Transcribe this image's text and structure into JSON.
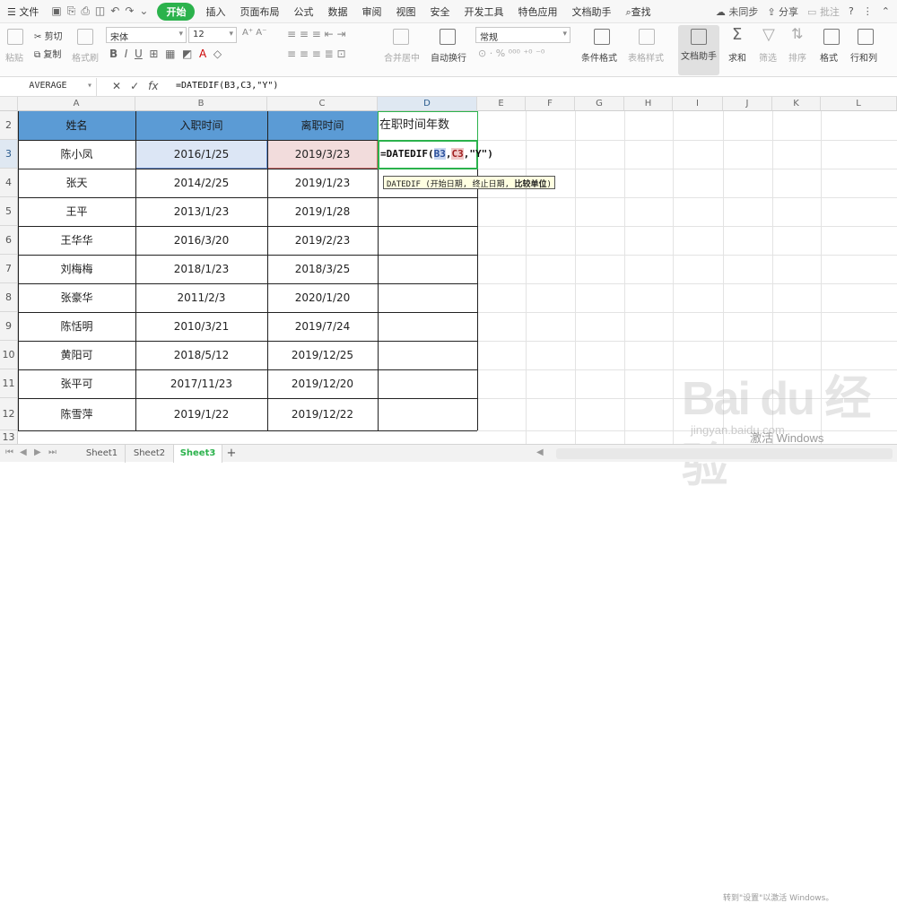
{
  "menubar": {
    "file": "文件",
    "tabs": [
      "开始",
      "插入",
      "页面布局",
      "公式",
      "数据",
      "审阅",
      "视图",
      "安全",
      "开发工具",
      "特色应用",
      "文档助手"
    ],
    "search": "查找",
    "sync": "未同步",
    "share": "分享",
    "comment": "批注",
    "help": "?"
  },
  "ribbon": {
    "paste": "粘贴",
    "cut": "剪切",
    "copy": "复制",
    "format_painter": "格式刷",
    "font_name": "宋体",
    "font_size": "12",
    "merge": "合并居中",
    "wrap": "自动换行",
    "number_format": "常规",
    "cond_format": "条件格式",
    "table_style": "表格样式",
    "doc_assist": "文档助手",
    "sum": "求和",
    "filter": "筛选",
    "sort": "排序",
    "format": "格式",
    "rowcol": "行和列"
  },
  "formula_bar": {
    "name_box": "AVERAGE",
    "formula": "=DATEDIF(B3,C3,\"Y\")"
  },
  "columns": [
    "A",
    "B",
    "C",
    "D",
    "E",
    "F",
    "G",
    "H",
    "I",
    "J",
    "K",
    "L"
  ],
  "rows": [
    "2",
    "3",
    "4",
    "5",
    "6",
    "7",
    "8",
    "9",
    "10",
    "11",
    "12",
    "13"
  ],
  "table": {
    "headers": [
      "姓名",
      "入职时间",
      "离职时间",
      "在职时间年数"
    ],
    "data": [
      [
        "陈小凤",
        "2016/1/25",
        "2019/3/23"
      ],
      [
        "张天",
        "2014/2/25",
        "2019/1/23"
      ],
      [
        "王平",
        "2013/1/23",
        "2019/1/28"
      ],
      [
        "王华华",
        "2016/3/20",
        "2019/2/23"
      ],
      [
        "刘梅梅",
        "2018/1/23",
        "2018/3/25"
      ],
      [
        "张豪华",
        "2011/2/3",
        "2020/1/20"
      ],
      [
        "陈恬明",
        "2010/3/21",
        "2019/7/24"
      ],
      [
        "黄阳可",
        "2018/5/12",
        "2019/12/25"
      ],
      [
        "张平可",
        "2017/11/23",
        "2019/12/20"
      ],
      [
        "陈雪萍",
        "2019/1/22",
        "2019/12/22"
      ]
    ],
    "editing_cell": {
      "prefix": "=DATEDIF(",
      "ref1": "B3",
      "sep": ",",
      "ref2": "C3",
      "suffix": ",\"Y\")"
    }
  },
  "tooltip": {
    "text": "DATEDIF (开始日期, 终止日期, ",
    "bold": "比较单位",
    "end": ")"
  },
  "sheets": [
    "Sheet1",
    "Sheet2",
    "Sheet3"
  ],
  "active_sheet": "Sheet3",
  "add_sheet": "+",
  "watermark": {
    "logo": "Bai du 经验",
    "site": "jingyan.baidu.com",
    "activate": "激活 Windows",
    "activate_sub": "转到\"设置\"以激活 Windows。"
  },
  "colors": {
    "accent": "#2bb24c",
    "header_fill": "#5b9bd5",
    "b3_fill": "#dce6f5",
    "c3_fill": "#f2dcdc"
  }
}
